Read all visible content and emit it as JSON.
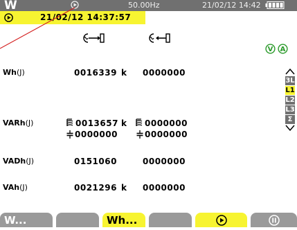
{
  "header": {
    "mode_letter": "W",
    "frequency": "50.00Hz",
    "datetime": "21/02/12 14:42"
  },
  "subheader": {
    "timestamp": "21/02/12 14:37:57"
  },
  "columns": {
    "consumed_icon": "energy-consumed-icon",
    "generated_icon": "energy-generated-icon",
    "scale_toggles": [
      "V",
      "A"
    ]
  },
  "rows": {
    "wh": {
      "label_main": "Wh",
      "label_unit": "(J)",
      "consumed": "0016339",
      "consumed_unit": "k",
      "generated": "0000000"
    },
    "varh": {
      "label_main": "VARh",
      "label_unit": "(J)",
      "consumed_ind": "0013657",
      "consumed_unit": "k",
      "generated_ind": "0000000",
      "consumed_cap": "0000000",
      "generated_cap": "0000000"
    },
    "vadh": {
      "label_main": "VADh",
      "label_unit": "(J)",
      "consumed": "0151060",
      "generated": "0000000"
    },
    "vah": {
      "label_main": "VAh",
      "label_unit": "(J)",
      "consumed": "0021296",
      "consumed_unit": "k",
      "generated": "0000000"
    }
  },
  "selector": {
    "items": [
      "3L",
      "L1",
      "L2",
      "L3",
      "Σ"
    ],
    "active": "L1"
  },
  "tabs": {
    "w": "W...",
    "wh": "Wh...",
    "play": "▶",
    "pause": "⏸"
  },
  "colors": {
    "accent_yellow": "#f7f431",
    "bar_gray": "#707070",
    "tab_gray": "#9a9a9a",
    "toggle_green": "#2a9a2a",
    "annotation_red": "#d42020"
  }
}
